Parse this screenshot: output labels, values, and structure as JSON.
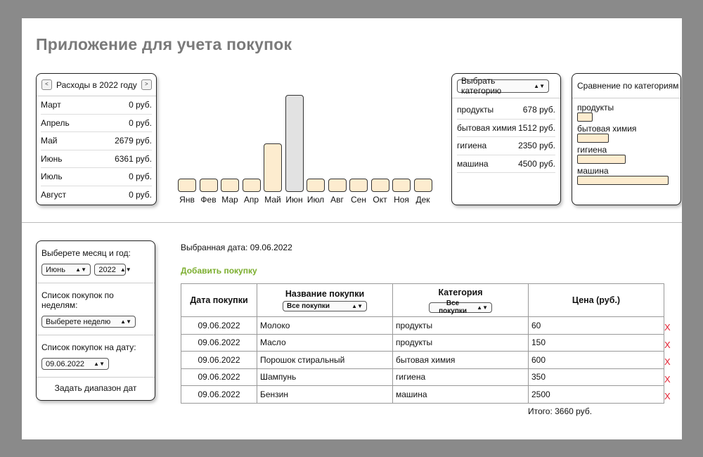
{
  "app": {
    "title": "Приложение для учета покупок"
  },
  "year_summary": {
    "prev_label": "<",
    "next_label": ">",
    "title": "Расходы в 2022 году",
    "months": [
      {
        "month": "Март",
        "amount": "0 руб."
      },
      {
        "month": "Апрель",
        "amount": "0 руб."
      },
      {
        "month": "Май",
        "amount": "2679 руб."
      },
      {
        "month": "Июнь",
        "amount": "6361 руб."
      },
      {
        "month": "Июль",
        "amount": "0 руб."
      },
      {
        "month": "Август",
        "amount": "0 руб."
      }
    ]
  },
  "chart_data": {
    "type": "bar",
    "categories": [
      "Янв",
      "Фев",
      "Мар",
      "Апр",
      "Май",
      "Июн",
      "Июл",
      "Авг",
      "Сен",
      "Окт",
      "Ноя",
      "Дек"
    ],
    "values": [
      0,
      0,
      0,
      0,
      2679,
      6361,
      0,
      0,
      0,
      0,
      0,
      0
    ],
    "selected": "Июн",
    "colors": {
      "bar": "#fdeccf",
      "selected": "#e2e2e2",
      "outline": "#333333"
    }
  },
  "category_panel": {
    "select_label": "Выбрать категорию",
    "items": [
      {
        "name": "продукты",
        "amount": "678 руб."
      },
      {
        "name": "бытовая химия",
        "amount": "1512 руб."
      },
      {
        "name": "гигиена",
        "amount": "2350 руб."
      },
      {
        "name": "машина",
        "amount": "4500 руб."
      }
    ]
  },
  "comparison": {
    "title": "Сравнение по категориям",
    "items": [
      {
        "name": "продукты",
        "value": 678
      },
      {
        "name": "бытовая химия",
        "value": 1512
      },
      {
        "name": "гигиена",
        "value": 2350
      },
      {
        "name": "машина",
        "value": 4500
      }
    ]
  },
  "filters": {
    "month_year_label": "Выберете месяц и год:",
    "month_value": "Июнь",
    "year_value": "2022",
    "weeks_label": "Список покупок по неделям:",
    "week_value": "Выберете неделю",
    "date_label": "Список покупок на дату:",
    "date_value": "09.06.2022",
    "range_button": "Задать диапазон дат"
  },
  "main": {
    "selected_date": "Выбранная дата: 09.06.2022",
    "add_link": "Добавить покупку",
    "columns": {
      "date": "Дата покупки",
      "name": "Название покупки",
      "name_filter": "Все покупки",
      "category": "Категория",
      "category_filter": "Все покупки",
      "price": "Цена (руб.)"
    },
    "rows": [
      {
        "date": "09.06.2022",
        "name": "Молоко",
        "category": "продукты",
        "price": "60"
      },
      {
        "date": "09.06.2022",
        "name": "Масло",
        "category": "продукты",
        "price": "150"
      },
      {
        "date": "09.06.2022",
        "name": "Порошок стиральный",
        "category": "бытовая химия",
        "price": "600"
      },
      {
        "date": "09.06.2022",
        "name": "Шампунь",
        "category": "гигиена",
        "price": "350"
      },
      {
        "date": "09.06.2022",
        "name": "Бензин",
        "category": "машина",
        "price": "2500"
      }
    ],
    "delete_label": "X",
    "total": "Итого: 3660 руб."
  },
  "colors": {
    "accent_green": "#7cae2f",
    "delete_red": "#e22233",
    "bar_fill": "#fdeccf"
  }
}
